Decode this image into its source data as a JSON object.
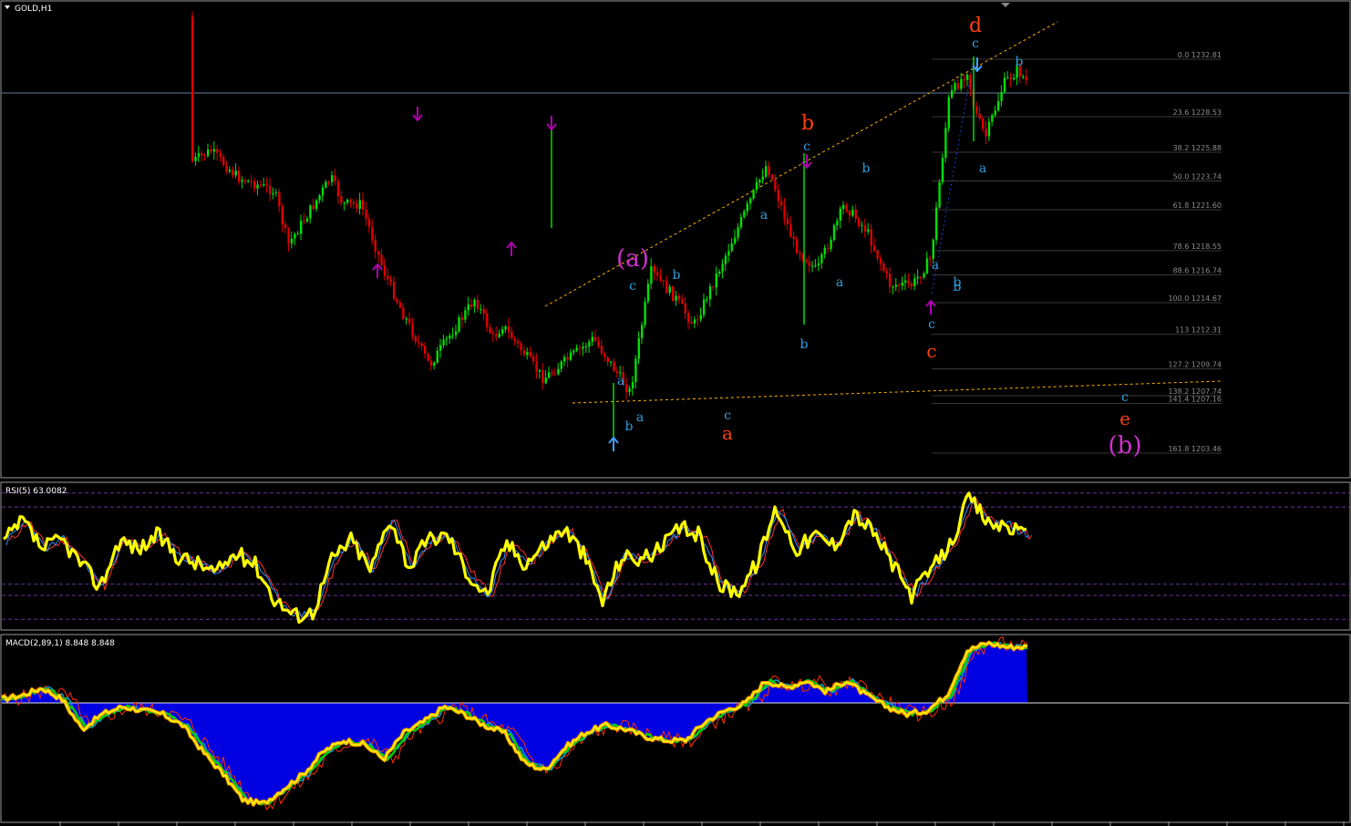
{
  "main": {
    "symbol": "GOLD,H1",
    "colors": {
      "bull": "#00e000",
      "bear": "#e00000",
      "fib": "#8c8c8c",
      "trend": "#ffb000",
      "arrow": "#b000b0",
      "arrow_blue": "#40a0ff"
    },
    "fib_levels": [
      {
        "label": "0.0 1232.81",
        "price": 1232.81
      },
      {
        "label": "23.6 1228.53",
        "price": 1228.53
      },
      {
        "label": "38.2 1225.88",
        "price": 1225.88
      },
      {
        "label": "50.0 1223.74",
        "price": 1223.74
      },
      {
        "label": "61.8 1221.60",
        "price": 1221.6
      },
      {
        "label": "78.6 1218.55",
        "price": 1218.55
      },
      {
        "label": "88.6 1216.74",
        "price": 1216.74
      },
      {
        "label": "100.0 1214.67",
        "price": 1214.67
      },
      {
        "label": "113 1212.31",
        "price": 1212.31
      },
      {
        "label": "127.2 1209.74",
        "price": 1209.74
      },
      {
        "label": "138.2 1207.74",
        "price": 1207.74
      },
      {
        "label": "141.4 1207.16",
        "price": 1207.16
      },
      {
        "label": "161.8 1203.46",
        "price": 1203.46
      }
    ],
    "wave_labels": [
      {
        "text": "(a)",
        "color": "#d030d0",
        "size": 26
      },
      {
        "text": "b",
        "color": "#ff4010",
        "size": 22
      },
      {
        "text": "d",
        "color": "#ff4010",
        "size": 22
      },
      {
        "text": "a",
        "color": "#ff4010",
        "size": 20
      },
      {
        "text": "c",
        "color": "#ff4010",
        "size": 20
      },
      {
        "text": "e",
        "color": "#ff4010",
        "size": 20
      },
      {
        "text": "(b)",
        "color": "#d030d0",
        "size": 26
      },
      {
        "text": "c",
        "color": "#30a0e0",
        "size": 14
      },
      {
        "text": "a",
        "color": "#30a0e0",
        "size": 14
      },
      {
        "text": "b",
        "color": "#30a0e0",
        "size": 14
      },
      {
        "text": "a",
        "color": "#30a0e0",
        "size": 14
      },
      {
        "text": "b",
        "color": "#30a0e0",
        "size": 14
      },
      {
        "text": "c",
        "color": "#30a0e0",
        "size": 14
      },
      {
        "text": "a",
        "color": "#30a0e0",
        "size": 14
      },
      {
        "text": "b",
        "color": "#30a0e0",
        "size": 14
      },
      {
        "text": "c",
        "color": "#30a0e0",
        "size": 14
      },
      {
        "text": "b",
        "color": "#30a0e0",
        "size": 14
      },
      {
        "text": "a",
        "color": "#30a0e0",
        "size": 14
      },
      {
        "text": "b",
        "color": "#30a0e0",
        "size": 14
      },
      {
        "text": "a",
        "color": "#30a0e0",
        "size": 14
      },
      {
        "text": "b",
        "color": "#30a0e0",
        "size": 14
      },
      {
        "text": "c",
        "color": "#30a0e0",
        "size": 14
      },
      {
        "text": "c",
        "color": "#30a0e0",
        "size": 14
      },
      {
        "text": "a",
        "color": "#30a0e0",
        "size": 14
      },
      {
        "text": "b",
        "color": "#30a0e0",
        "size": 14
      },
      {
        "text": "c",
        "color": "#30a0e0",
        "size": 14
      }
    ]
  },
  "rsi": {
    "title": "RSI(5) 63.0082",
    "colors": {
      "main": "#ffff00",
      "fast": "#3090ff",
      "slow": "#ff3030",
      "levels": "#7030a0"
    }
  },
  "macd": {
    "title": "MACD(2,89,1) 8.848 8.848",
    "colors": {
      "hist": "#0000e0",
      "orange": "#ffa000",
      "yellow": "#ffff00",
      "green": "#00d000",
      "cyan": "#00a0d0",
      "red": "#ff3000"
    }
  },
  "chart_data": [
    {
      "type": "candlestick",
      "title": "GOLD,H1",
      "price_levels": [
        1232.81,
        1228.53,
        1225.88,
        1223.74,
        1221.6,
        1218.55,
        1216.74,
        1214.67,
        1212.31,
        1209.74,
        1207.74,
        1207.16,
        1203.46
      ],
      "x": [
        0,
        24,
        48,
        60,
        90,
        125,
        145,
        165,
        180,
        230,
        260,
        300,
        315,
        362,
        375,
        395,
        420,
        440,
        470,
        520,
        540,
        550,
        595,
        650,
        690,
        713,
        740,
        760,
        800,
        840,
        870,
        895,
        925,
        950,
        975,
        1000,
        1020,
        1040,
        1060,
        1068,
        1080,
        1100,
        1115,
        1127
      ],
      "close": [
        1236,
        1233,
        1230,
        1226,
        1221,
        1220,
        1223,
        1225,
        1224,
        1226,
        1224,
        1223,
        1219,
        1224,
        1222,
        1222,
        1217,
        1214,
        1210,
        1215,
        1212,
        1213,
        1209,
        1212,
        1208,
        1217,
        1215,
        1213,
        1219,
        1225,
        1219,
        1217,
        1222,
        1220,
        1216,
        1216,
        1218,
        1230,
        1232,
        1229,
        1227,
        1231,
        1232,
        1231
      ]
    },
    {
      "type": "line",
      "title": "RSI(5) 63.0082",
      "ylim": [
        0,
        100
      ],
      "levels": [
        95,
        85,
        30,
        22,
        5
      ],
      "series": [
        {
          "values": [
            60,
            75,
            55,
            62,
            45,
            28,
            62,
            55,
            65,
            50,
            45,
            38,
            52,
            45,
            20,
            8,
            10,
            48,
            62,
            40,
            78,
            42,
            62,
            65,
            38,
            22,
            60,
            45,
            58,
            70,
            52,
            18,
            50,
            48,
            55,
            70,
            65,
            30,
            25,
            45,
            85,
            55,
            65,
            58,
            80,
            68,
            45,
            22,
            40,
            58,
            92,
            73,
            72,
            63
          ]
        }
      ]
    },
    {
      "type": "area",
      "title": "MACD(2,89,1) 8.848 8.848",
      "series": [
        {
          "values": [
            1,
            2,
            4,
            1,
            -7,
            -3,
            -1,
            -2,
            -3,
            -6,
            -13,
            -19,
            -26,
            -27,
            -23,
            -19,
            -13,
            -10,
            -11,
            -15,
            -8,
            -5,
            -1,
            -3,
            -6,
            -8,
            -16,
            -18,
            -12,
            -8,
            -6,
            -7,
            -9,
            -10,
            -10,
            -5,
            -2,
            0,
            6,
            4,
            6,
            3,
            6,
            2,
            -1,
            -3,
            -2,
            2,
            14,
            16,
            15,
            15
          ]
        }
      ]
    }
  ]
}
